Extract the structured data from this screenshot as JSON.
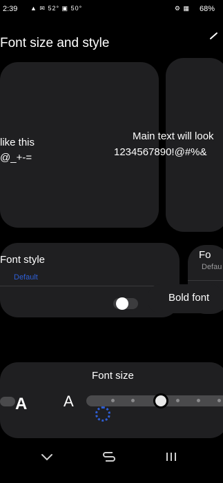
{
  "status_bar": {
    "time": "2:39",
    "left_icons": "▲ ✉ 52° ▣ 50°",
    "right_icons": "⚙ ▦",
    "battery": "68%"
  },
  "header": {
    "title": "Font size and style"
  },
  "preview": {
    "left_line1": "like this",
    "left_line2": "@_+-=",
    "right_line1": "Main text will look",
    "right_line2": "1234567890!@#%&"
  },
  "font_style": {
    "label": "Font style",
    "value": "Default",
    "right_label": "Fo",
    "right_value": "Defau"
  },
  "bold_font": {
    "label": "Bold font",
    "toggle_on": false
  },
  "font_size": {
    "label": "Font size",
    "small_a": "A",
    "large_a": "A",
    "level_fraction": 0.3
  },
  "nav": {
    "back_icon": "chevron-down-icon",
    "home_icon": "home-icon",
    "recents_icon": "recents-icon"
  },
  "colors": {
    "background": "#000000",
    "card": "#1f1f21",
    "accent": "#2f5fd6"
  }
}
